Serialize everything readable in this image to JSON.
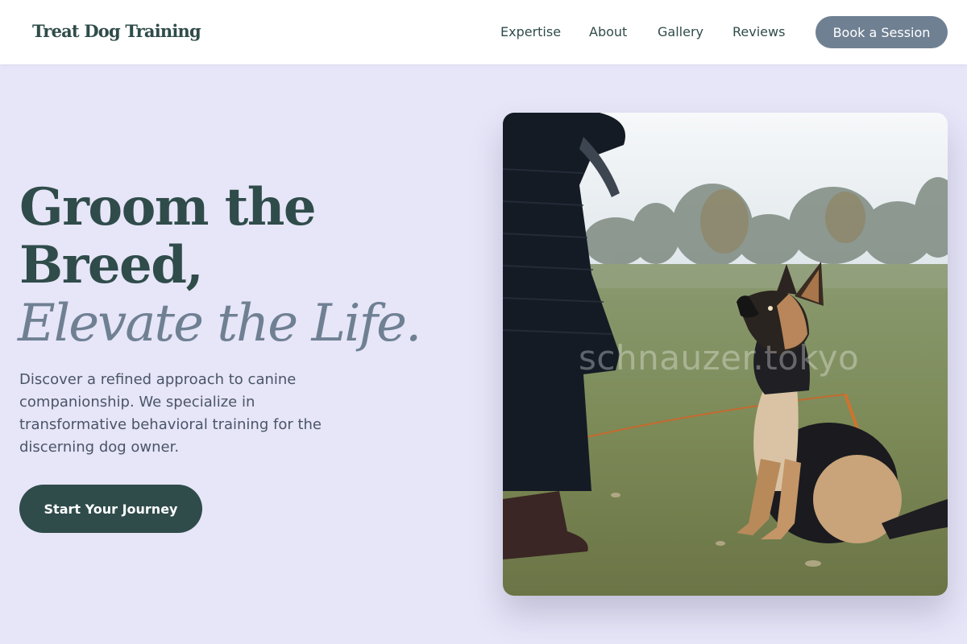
{
  "header": {
    "logo": "Treat Dog Training",
    "nav": [
      "Expertise",
      "About",
      "Gallery",
      "Reviews"
    ],
    "cta_label": "Book a Session"
  },
  "hero": {
    "headline_line1": "Groom the",
    "headline_line2": "Breed,",
    "headline_italic": "Elevate the Life.",
    "description": "Discover a refined approach to canine companionship. We specialize in transformative behavioral training for the discerning dog owner.",
    "cta_label": "Start Your Journey",
    "image": {
      "subject": "German Shepherd puppy sitting on grass looking up at owner",
      "watermark": "schnauzer.tokyo"
    }
  },
  "colors": {
    "page_background": "#e7e5f8",
    "header_background": "#ffffff",
    "primary": "#2f4c4a",
    "accent": "#6f8093",
    "body_text": "#4a5568"
  }
}
